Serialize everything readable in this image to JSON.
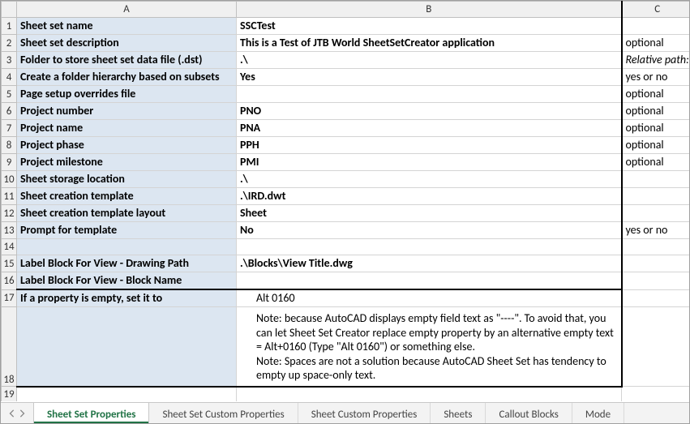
{
  "columns": {
    "A": "A",
    "B": "B",
    "C": "C"
  },
  "rows": [
    {
      "n": 1,
      "label": "Sheet set name",
      "value": "SSCTest",
      "opt": ""
    },
    {
      "n": 2,
      "label": "Sheet set description",
      "value": "This is a Test of JTB World SheetSetCreator application",
      "opt": "optional"
    },
    {
      "n": 3,
      "label": "Folder to store sheet set data file (.dst)",
      "value": ".\\",
      "opt": "Relative path:"
    },
    {
      "n": 4,
      "label": "Create a folder hierarchy based on subsets",
      "value": "Yes",
      "opt": "yes or no"
    },
    {
      "n": 5,
      "label": "Page setup overrides file",
      "value": "",
      "opt": "optional"
    },
    {
      "n": 6,
      "label": "Project number",
      "value": "PNO",
      "opt": "optional"
    },
    {
      "n": 7,
      "label": "Project name",
      "value": "PNA",
      "opt": "optional"
    },
    {
      "n": 8,
      "label": "Project phase",
      "value": "PPH",
      "opt": "optional"
    },
    {
      "n": 9,
      "label": "Project milestone",
      "value": "PMI",
      "opt": "optional"
    },
    {
      "n": 10,
      "label": "Sheet storage location",
      "value": ".\\",
      "opt": ""
    },
    {
      "n": 11,
      "label": "Sheet creation template",
      "value": ".\\IRD.dwt",
      "opt": ""
    },
    {
      "n": 12,
      "label": "Sheet creation template layout",
      "value": "Sheet",
      "opt": ""
    },
    {
      "n": 13,
      "label": "Prompt for template",
      "value": "No",
      "opt": "yes or no"
    },
    {
      "n": 14,
      "label": "",
      "value": "",
      "opt": ""
    },
    {
      "n": 15,
      "label": "Label Block For View - Drawing Path",
      "value": ".\\Blocks\\View Title.dwg",
      "opt": ""
    },
    {
      "n": 16,
      "label": "Label Block For View - Block Name",
      "value": "",
      "opt": ""
    }
  ],
  "row17": {
    "n": 17,
    "label": "If a property is empty, set it to",
    "value": "Alt 0160",
    "opt": ""
  },
  "row18": {
    "n": 18,
    "note": "Note: because AutoCAD displays empty field text as \"----\". To avoid that, you can let Sheet Set Creator replace empty property by an alternative empty text = Alt+0160 (Type \"Alt 0160\") or something else.\nNote: Spaces are not a solution because AutoCAD Sheet Set has tendency to empty up space-only text."
  },
  "row19": {
    "n": 19
  },
  "tabs": [
    {
      "label": "Sheet Set Properties",
      "active": true
    },
    {
      "label": "Sheet Set Custom Properties",
      "active": false
    },
    {
      "label": "Sheet Custom Properties",
      "active": false
    },
    {
      "label": "Sheets",
      "active": false
    },
    {
      "label": "Callout Blocks",
      "active": false
    },
    {
      "label": "Mode",
      "active": false
    }
  ]
}
